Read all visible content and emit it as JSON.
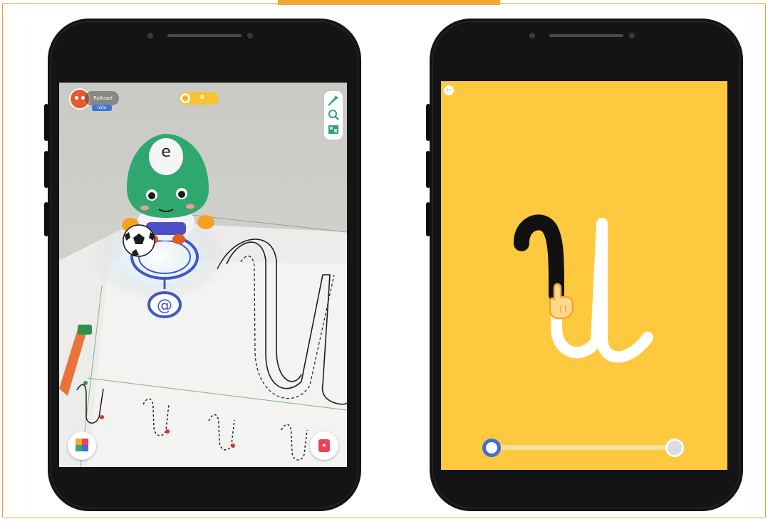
{
  "left_screen": {
    "user_name": "Rollosol",
    "user_level": "niño",
    "coin_count": "0",
    "toolbar_icons": [
      "pin-icon",
      "search-icon",
      "map-icon"
    ],
    "cube_button_icon": "abc-cube-icon",
    "card_button_icon": "card-icon",
    "card_button_glyph": "★",
    "trace_letter": "u",
    "sheet_label_letter": "u"
  },
  "right_screen": {
    "back_glyph": "←",
    "trace_letter": "u",
    "trace_progress": 0.0,
    "colors": {
      "background": "#fec93e",
      "trace_done": "#111111",
      "trace_pending": "#ffffff",
      "slider_accent": "#3f6fd6"
    }
  },
  "colors": {
    "frame_border": "#e8a33a",
    "tab": "#f2a634",
    "phone_body": "#141414"
  }
}
